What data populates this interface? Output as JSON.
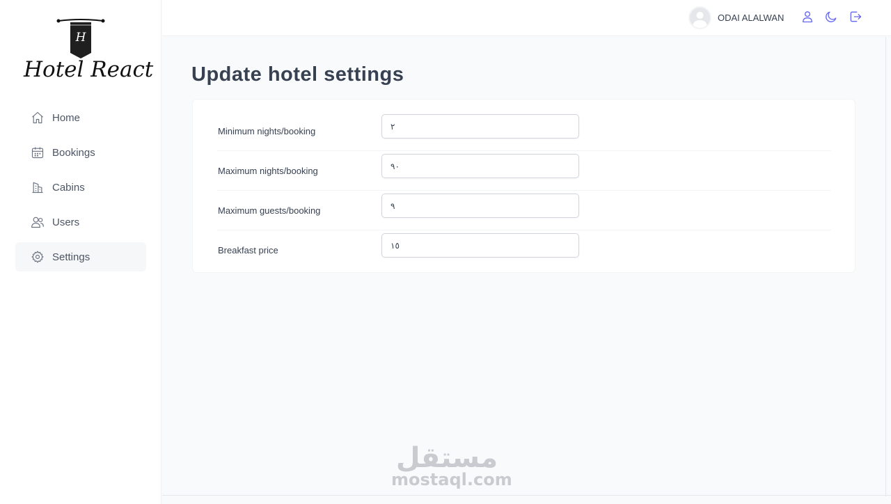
{
  "brand": {
    "logo_letter": "H",
    "name": "Hotel React"
  },
  "sidebar": {
    "items": [
      {
        "label": "Home",
        "icon": "home-icon",
        "active": false
      },
      {
        "label": "Bookings",
        "icon": "calendar-icon",
        "active": false
      },
      {
        "label": "Cabins",
        "icon": "building-icon",
        "active": false
      },
      {
        "label": "Users",
        "icon": "users-icon",
        "active": false
      },
      {
        "label": "Settings",
        "icon": "gear-icon",
        "active": true
      }
    ]
  },
  "header": {
    "user_name": "ODAI ALALWAN",
    "buttons": [
      "user-icon",
      "moon-icon",
      "logout-icon"
    ]
  },
  "main": {
    "title": "Update hotel settings",
    "settings": [
      {
        "label": "Minimum nights/booking",
        "value": "٢"
      },
      {
        "label": "Maximum nights/booking",
        "value": "٩٠"
      },
      {
        "label": "Maximum guests/booking",
        "value": "٩"
      },
      {
        "label": "Breakfast price",
        "value": "١٥"
      }
    ]
  },
  "watermark": {
    "arabic": "مستقل",
    "latin": "mostaql.com"
  },
  "colors": {
    "background": "#f9fafb",
    "surface": "#ffffff",
    "text": "#374151",
    "active_nav": "#f6f7f9"
  }
}
